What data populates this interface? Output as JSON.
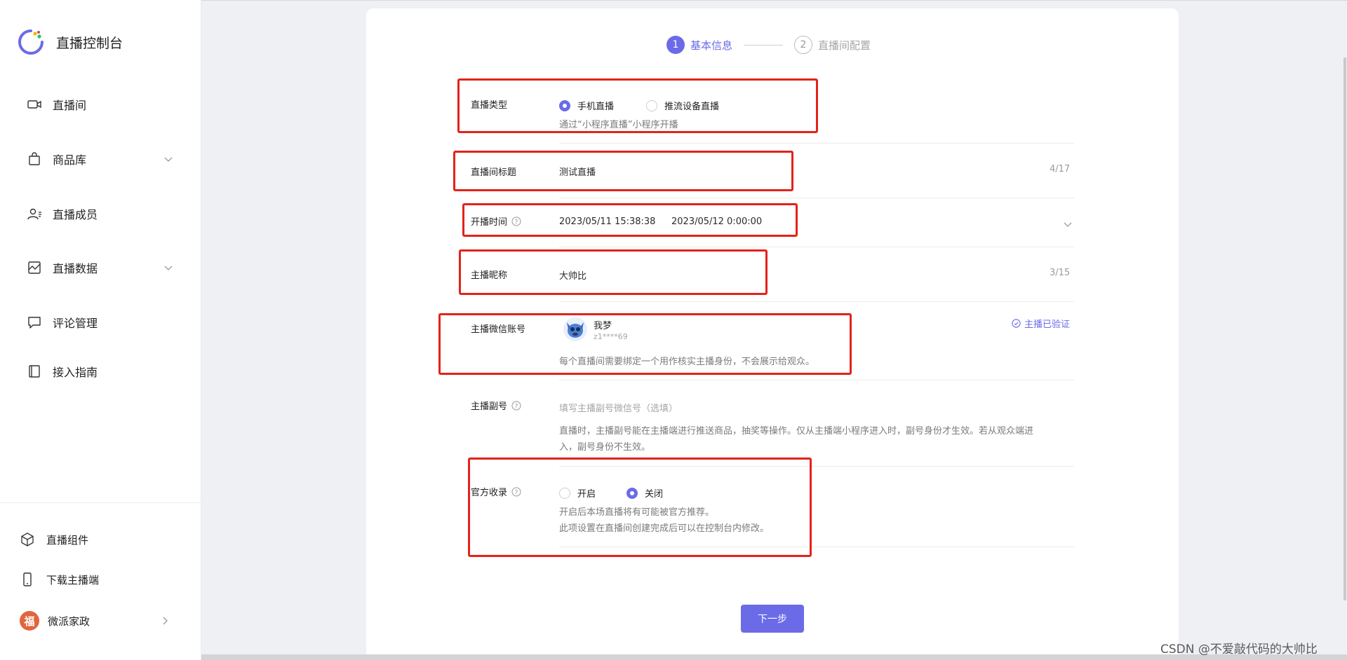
{
  "sidebar": {
    "brand_title": "直播控制台",
    "nav": [
      {
        "label": "直播间",
        "icon": "video-camera-icon"
      },
      {
        "label": "商品库",
        "icon": "shopping-bag-icon"
      },
      {
        "label": "直播成员",
        "icon": "user-list-icon"
      },
      {
        "label": "直播数据",
        "icon": "chart-icon"
      },
      {
        "label": "评论管理",
        "icon": "comment-icon"
      },
      {
        "label": "接入指南",
        "icon": "book-icon"
      }
    ],
    "footer": [
      {
        "label": "直播组件",
        "icon": "cube-icon"
      },
      {
        "label": "下载主播端",
        "icon": "phone-icon"
      },
      {
        "label": "微派家政",
        "avatar_char": "福"
      }
    ]
  },
  "steps": {
    "step1": {
      "num": "1",
      "label": "基本信息"
    },
    "step2": {
      "num": "2",
      "label": "直播间配置"
    }
  },
  "form": {
    "live_type": {
      "label": "直播类型",
      "option_phone": "手机直播",
      "option_device": "推流设备直播",
      "selected": "手机直播",
      "hint": "通过“小程序直播”小程序开播"
    },
    "title": {
      "label": "直播间标题",
      "value": "测试直播",
      "counter": "4/17"
    },
    "time": {
      "label": "开播时间",
      "start": "2023/05/11 15:38:38",
      "end": "2023/05/12 0:00:00"
    },
    "nickname": {
      "label": "主播昵称",
      "value": "大帅比",
      "counter": "3/15"
    },
    "wechat": {
      "label": "主播微信账号",
      "name": "我梦",
      "account": "z1****69",
      "verified": "主播已验证",
      "hint": "每个直播间需要绑定一个用作核实主播身份，不会展示给观众。"
    },
    "deputy": {
      "label": "主播副号",
      "placeholder": "填写主播副号微信号（选填）",
      "hint_line1": "直播时，主播副号能在主播端进行推送商品，抽奖等操作。仅从主播端小程序进入时，副号身份才生效。若从观众端进",
      "hint_line2": "入，副号身份不生效。"
    },
    "official": {
      "label": "官方收录",
      "option_on": "开启",
      "option_off": "关闭",
      "selected": "关闭",
      "hint_line1": "开启后本场直播将有可能被官方推荐。",
      "hint_line2": "此项设置在直播间创建完成后可以在控制台内修改。"
    }
  },
  "next_button": "下一步",
  "watermark": "CSDN @不爱敲代码的大帅比",
  "colors": {
    "accent": "#6b6be8",
    "highlight_box": "#e3221a"
  }
}
